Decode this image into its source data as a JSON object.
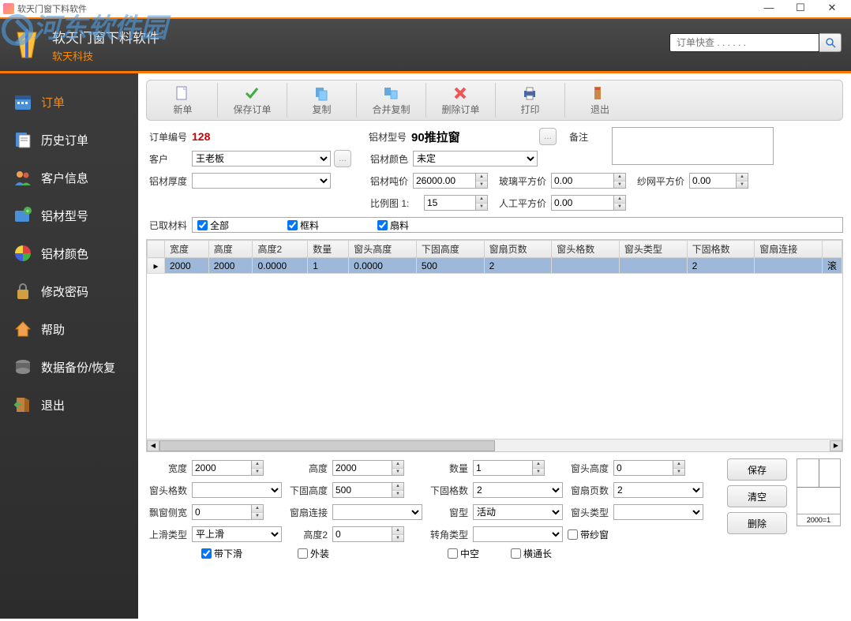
{
  "window": {
    "title": "软天门窗下料软件"
  },
  "header": {
    "title": "软天门窗下料软件",
    "subtitle": "软天科技",
    "search_placeholder": "订单快查 . . . . . ."
  },
  "watermark": "河东软件园",
  "sidebar": {
    "items": [
      {
        "label": "订单",
        "active": true
      },
      {
        "label": "历史订单"
      },
      {
        "label": "客户信息"
      },
      {
        "label": "铝材型号"
      },
      {
        "label": "铝材颜色"
      },
      {
        "label": "修改密码"
      },
      {
        "label": "帮助"
      },
      {
        "label": "数据备份/恢复"
      },
      {
        "label": "退出"
      }
    ]
  },
  "toolbar": {
    "items": [
      {
        "label": "新单"
      },
      {
        "label": "保存订单"
      },
      {
        "label": "复制"
      },
      {
        "label": "合并复制"
      },
      {
        "label": "删除订单"
      },
      {
        "label": "打印"
      },
      {
        "label": "退出"
      }
    ]
  },
  "form": {
    "order_no_label": "订单编号",
    "order_no": "128",
    "model_label": "铝材型号",
    "model": "90推拉窗",
    "remark_label": "备注",
    "remark": "",
    "customer_label": "客户",
    "customer": "王老板",
    "color_label": "铝材颜色",
    "color": "未定",
    "thickness_label": "铝材厚度",
    "thickness": "",
    "ton_price_label": "铝材吨价",
    "ton_price": "26000.00",
    "glass_price_label": "玻璃平方价",
    "glass_price": "0.00",
    "net_price_label": "纱网平方价",
    "net_price": "0.00",
    "ratio_label": "比例图  1:",
    "ratio": "15",
    "labor_price_label": "人工平方价",
    "labor_price": "0.00",
    "materials_label": "已取材料",
    "chk_all": "全部",
    "chk_frame": "框料",
    "chk_fan": "扇料"
  },
  "grid": {
    "columns": [
      "宽度",
      "高度",
      "高度2",
      "数量",
      "窗头高度",
      "下固高度",
      "窗扇页数",
      "窗头格数",
      "窗头类型",
      "下固格数",
      "窗扇连接",
      ""
    ],
    "rows": [
      {
        "cells": [
          "2000",
          "2000",
          "0.0000",
          "1",
          "0.0000",
          "500",
          "2",
          "",
          "",
          "2",
          "",
          "滚"
        ]
      }
    ]
  },
  "bottom": {
    "width_label": "宽度",
    "width": "2000",
    "height_label": "高度",
    "height": "2000",
    "qty_label": "数量",
    "qty": "1",
    "head_h_label": "窗头高度",
    "head_h": "0",
    "head_g_label": "窗头格数",
    "head_g": "",
    "lowfix_h_label": "下固高度",
    "lowfix_h": "500",
    "lowfix_g_label": "下固格数",
    "lowfix_g": "2",
    "fan_pages_label": "窗扇页数",
    "fan_pages": "2",
    "bay_sw_label": "飘窗侧宽",
    "bay_sw": "0",
    "fan_conn_label": "窗扇连接",
    "fan_conn": "",
    "wtype_label": "窗型",
    "wtype": "活动",
    "head_type_label": "窗头类型",
    "head_type": "",
    "upslide_label": "上滑类型",
    "upslide": "平上滑",
    "h2_label": "高度2",
    "h2": "0",
    "corner_label": "转角类型",
    "corner": "",
    "chk_screen": "带纱窗",
    "chk_downslide": "带下滑",
    "chk_outwear": "外装",
    "chk_hollow": "中空",
    "chk_hbar": "横通长",
    "btn_save": "保存",
    "btn_clear": "清空",
    "btn_delete": "删除",
    "preview_label": "2000=1"
  }
}
